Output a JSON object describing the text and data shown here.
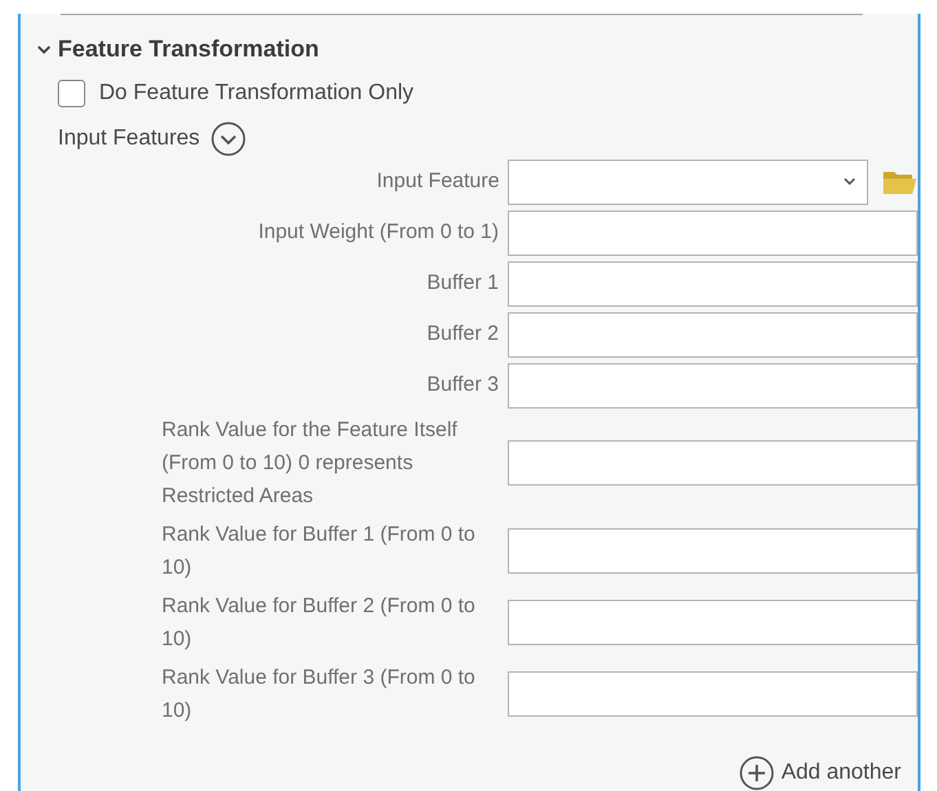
{
  "section": {
    "title": "Feature Transformation",
    "expanded": true
  },
  "checkbox": {
    "label": "Do Feature Transformation Only",
    "checked": false
  },
  "group": {
    "label": "Input Features",
    "expanded": true
  },
  "fields": [
    {
      "kind": "dropdown",
      "label": "Input Feature"
    },
    {
      "kind": "text",
      "label": "Input Weight (From 0 to 1)"
    },
    {
      "kind": "text",
      "label": "Buffer 1"
    },
    {
      "kind": "text",
      "label": "Buffer 2"
    },
    {
      "kind": "text",
      "label": "Buffer 3"
    },
    {
      "kind": "text",
      "label": "Rank Value  for the Feature Itself (From 0 to 10) 0 represents Restricted Areas"
    },
    {
      "kind": "text",
      "label": "Rank Value for Buffer 1 (From 0 to 10)"
    },
    {
      "kind": "text",
      "label": "Rank Value for Buffer 2 (From 0 to 10)"
    },
    {
      "kind": "text",
      "label": "Rank Value for Buffer 3 (From 0 to 10)"
    }
  ],
  "add_button": {
    "label": "Add another"
  }
}
